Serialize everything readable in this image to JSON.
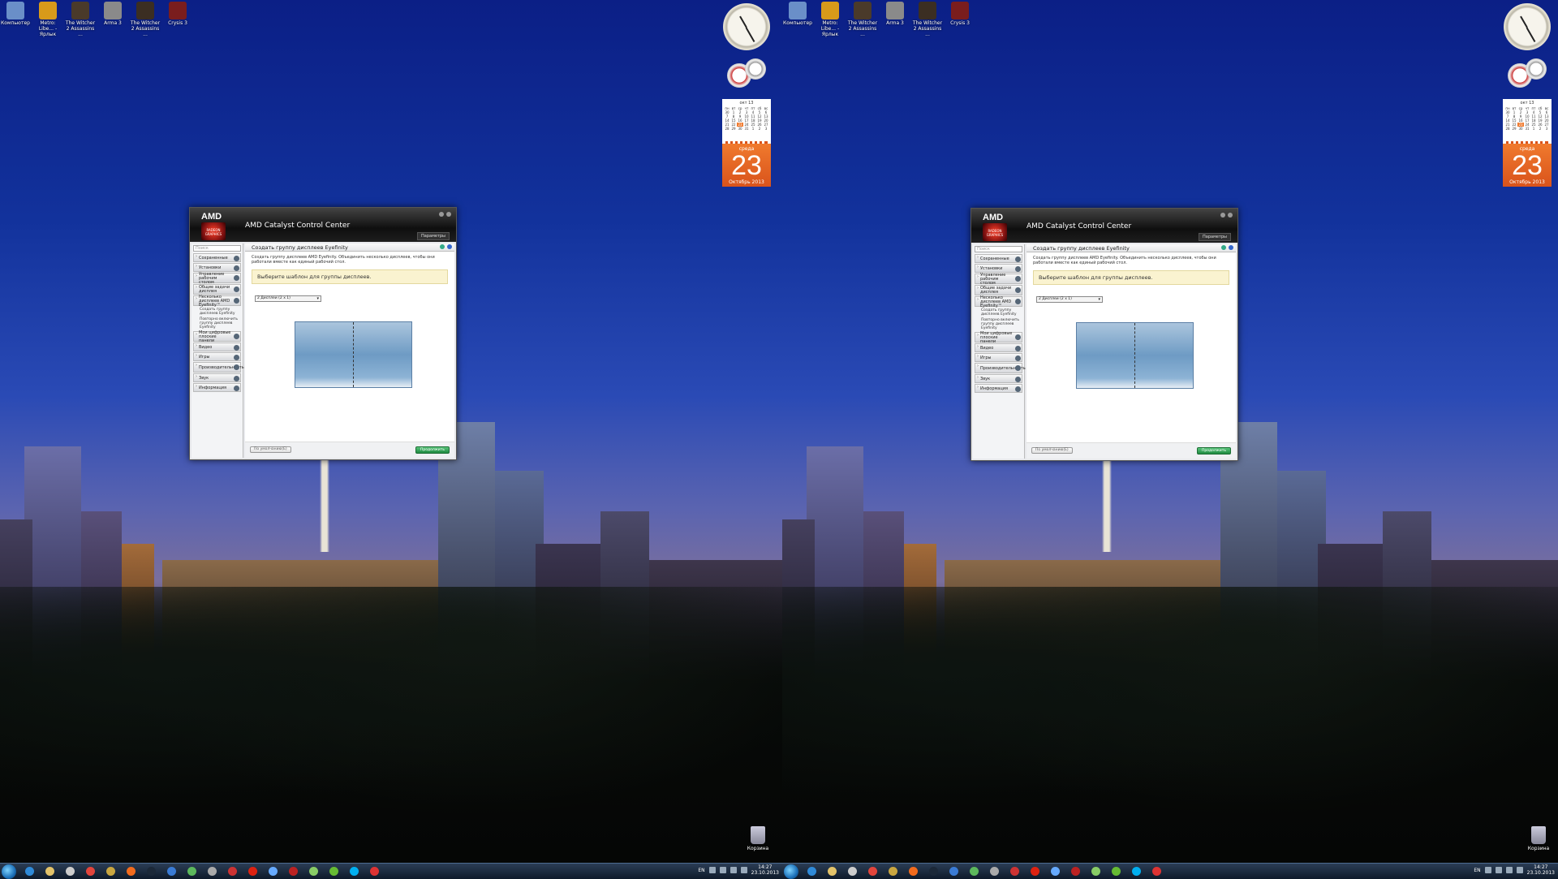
{
  "desktop": {
    "icons": [
      {
        "label": "Компьютер",
        "icon": "computer-icon",
        "color": "#6a8fc8"
      },
      {
        "label": "Metro: Libe... - Ярлык",
        "icon": "metro-icon",
        "color": "#d89a1a"
      },
      {
        "label": "The Witcher 2 Assassins ...",
        "icon": "witcher-icon",
        "color": "#4a3a2a"
      },
      {
        "label": "Arma 3",
        "icon": "arma-icon",
        "color": "#8a8a8a"
      },
      {
        "label": "The Witcher 2 Assassins ...",
        "icon": "witcher-icon",
        "color": "#3b2e22"
      },
      {
        "label": "Crysis 3",
        "icon": "crysis-icon",
        "color": "#7a1d1d"
      }
    ],
    "recycle_bin": "Корзина"
  },
  "calendar": {
    "month_title": "окт 13",
    "weekdays": [
      "пн",
      "вт",
      "ср",
      "чт",
      "пт",
      "сб",
      "вс"
    ],
    "days": [
      "30",
      "1",
      "2",
      "3",
      "4",
      "5",
      "6",
      "7",
      "8",
      "9",
      "10",
      "11",
      "12",
      "13",
      "14",
      "15",
      "16",
      "17",
      "18",
      "19",
      "20",
      "21",
      "22",
      "23",
      "24",
      "25",
      "26",
      "27",
      "28",
      "29",
      "30",
      "31",
      "1",
      "2",
      "3"
    ],
    "day_of_week": "среда",
    "day": "23",
    "month_year": "Октябрь 2013"
  },
  "window": {
    "app_title": "AMD Catalyst Control Center",
    "brand": "AMD",
    "logo_sub": "RADEON GRAPHICS",
    "params_label": "Параметры",
    "search_placeholder": "Поиск",
    "nav": [
      {
        "label": "Сохраненные",
        "tall": false
      },
      {
        "label": "Установки",
        "tall": false
      },
      {
        "label": "Управление рабочим столом",
        "tall": true
      },
      {
        "label": "Общие задачи дисплея",
        "tall": true
      },
      {
        "label": "Несколько дисплеев AMD Eyefinity™",
        "tall": true
      }
    ],
    "sub_items": [
      "Создать группу дисплеев Eyefinity",
      "Повторно включить группу дисплеев Eyefinity"
    ],
    "nav_more": [
      {
        "label": "Мои цифровые плоские панели",
        "tall": true
      },
      {
        "label": "Видео",
        "tall": false
      },
      {
        "label": "Игры",
        "tall": false
      },
      {
        "label": "Производительность",
        "tall": true
      },
      {
        "label": "Звук",
        "tall": false
      },
      {
        "label": "Информация",
        "tall": false
      }
    ],
    "page_title": "Создать группу дисплеев Eyefinity",
    "description": "Создать группу дисплеев AMD Eyefinity. Объединить несколько дисплеев, чтобы они работали вместе как единый рабочий стол.",
    "hint": "Выберите шаблон для группы дисплеев.",
    "select_value": "2 Дисплеи (2 x 1)",
    "default_button": "По умолчанию(E)",
    "next_button": "Продолжить"
  },
  "taskbar": {
    "apps": [
      {
        "icon": "ie-icon",
        "color": "#2f8ad8"
      },
      {
        "icon": "explorer-icon",
        "color": "#e3c36a"
      },
      {
        "icon": "media-player-icon",
        "color": "#ccc"
      },
      {
        "icon": "chrome-icon",
        "color": "#e2453c"
      },
      {
        "icon": "winamp-icon",
        "color": "#c9a640"
      },
      {
        "icon": "origin-icon",
        "color": "#f26b1d"
      },
      {
        "icon": "steam-icon",
        "color": "#1b2838"
      },
      {
        "icon": "uplay-icon",
        "color": "#3a7bd5"
      },
      {
        "icon": "xbox-icon",
        "color": "#5cb85c"
      },
      {
        "icon": "network-icon",
        "color": "#aaa"
      },
      {
        "icon": "avatar-icon",
        "color": "#c33"
      },
      {
        "icon": "opera-icon",
        "color": "#d21"
      },
      {
        "icon": "save-icon",
        "color": "#6af"
      },
      {
        "icon": "64-icon",
        "color": "#b22"
      },
      {
        "icon": "download-icon",
        "color": "#8c6"
      },
      {
        "icon": "utorrent-icon",
        "color": "#6b3"
      },
      {
        "icon": "skype-icon",
        "color": "#00aff0"
      },
      {
        "icon": "amd-icon",
        "color": "#d33"
      }
    ],
    "lang": "EN",
    "time": "14:27",
    "date": "23.10.2013"
  }
}
